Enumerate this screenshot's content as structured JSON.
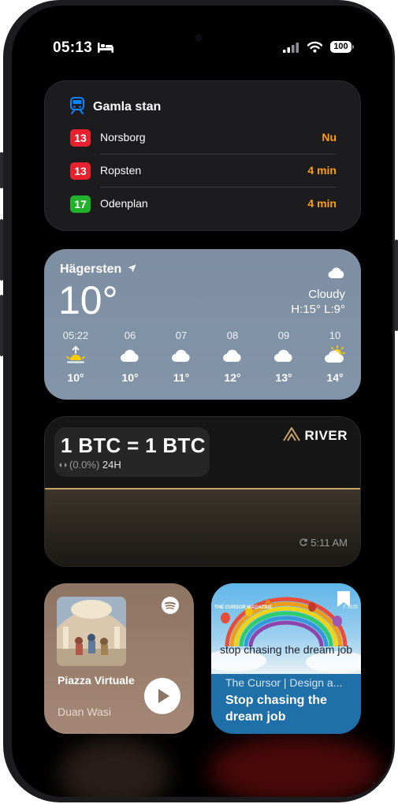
{
  "status_bar": {
    "time": "05:13",
    "battery": "100",
    "icons": [
      "bed-icon",
      "cellular-signal-icon",
      "wifi-icon",
      "battery-icon"
    ]
  },
  "transit_widget": {
    "station": "Gamla stan",
    "icon": "train-icon",
    "departures": [
      {
        "line": "13",
        "destination": "Norsborg",
        "eta": "Nu",
        "color": "#e8212e"
      },
      {
        "line": "13",
        "destination": "Ropsten",
        "eta": "4 min",
        "color": "#e8212e"
      },
      {
        "line": "17",
        "destination": "Odenplan",
        "eta": "4 min",
        "color": "#1fb22a"
      }
    ],
    "eta_color": "#ff9f0a"
  },
  "weather_widget": {
    "location": "Hägersten",
    "temperature": "10°",
    "condition": "Cloudy",
    "high_low": "H:15° L:9°",
    "hourly": [
      {
        "hour": "05:22",
        "icon": "sunrise-icon",
        "temp": "10°"
      },
      {
        "hour": "06",
        "icon": "cloud-icon",
        "temp": "10°"
      },
      {
        "hour": "07",
        "icon": "cloud-icon",
        "temp": "11°"
      },
      {
        "hour": "08",
        "icon": "cloud-icon",
        "temp": "12°"
      },
      {
        "hour": "09",
        "icon": "cloud-icon",
        "temp": "13°"
      },
      {
        "hour": "10",
        "icon": "partly-sunny-icon",
        "temp": "14°"
      }
    ]
  },
  "river_widget": {
    "price": "1 BTC = 1 BTC",
    "change": "(0.0%)",
    "period": "24H",
    "brand": "RIVER",
    "updated": "5:11 AM",
    "accent": "#c8a368"
  },
  "music_widget": {
    "title": "Piazza Virtuale",
    "artist": "Duan Wasi",
    "service_icon": "spotify-icon"
  },
  "podcast_widget": {
    "magazine": "THE CURSOR MAGAZINE",
    "year": "F 2025",
    "art_headline": "stop chasing the dream job",
    "show": "The Cursor | Design a...",
    "episode": "Stop chasing the dream job"
  }
}
